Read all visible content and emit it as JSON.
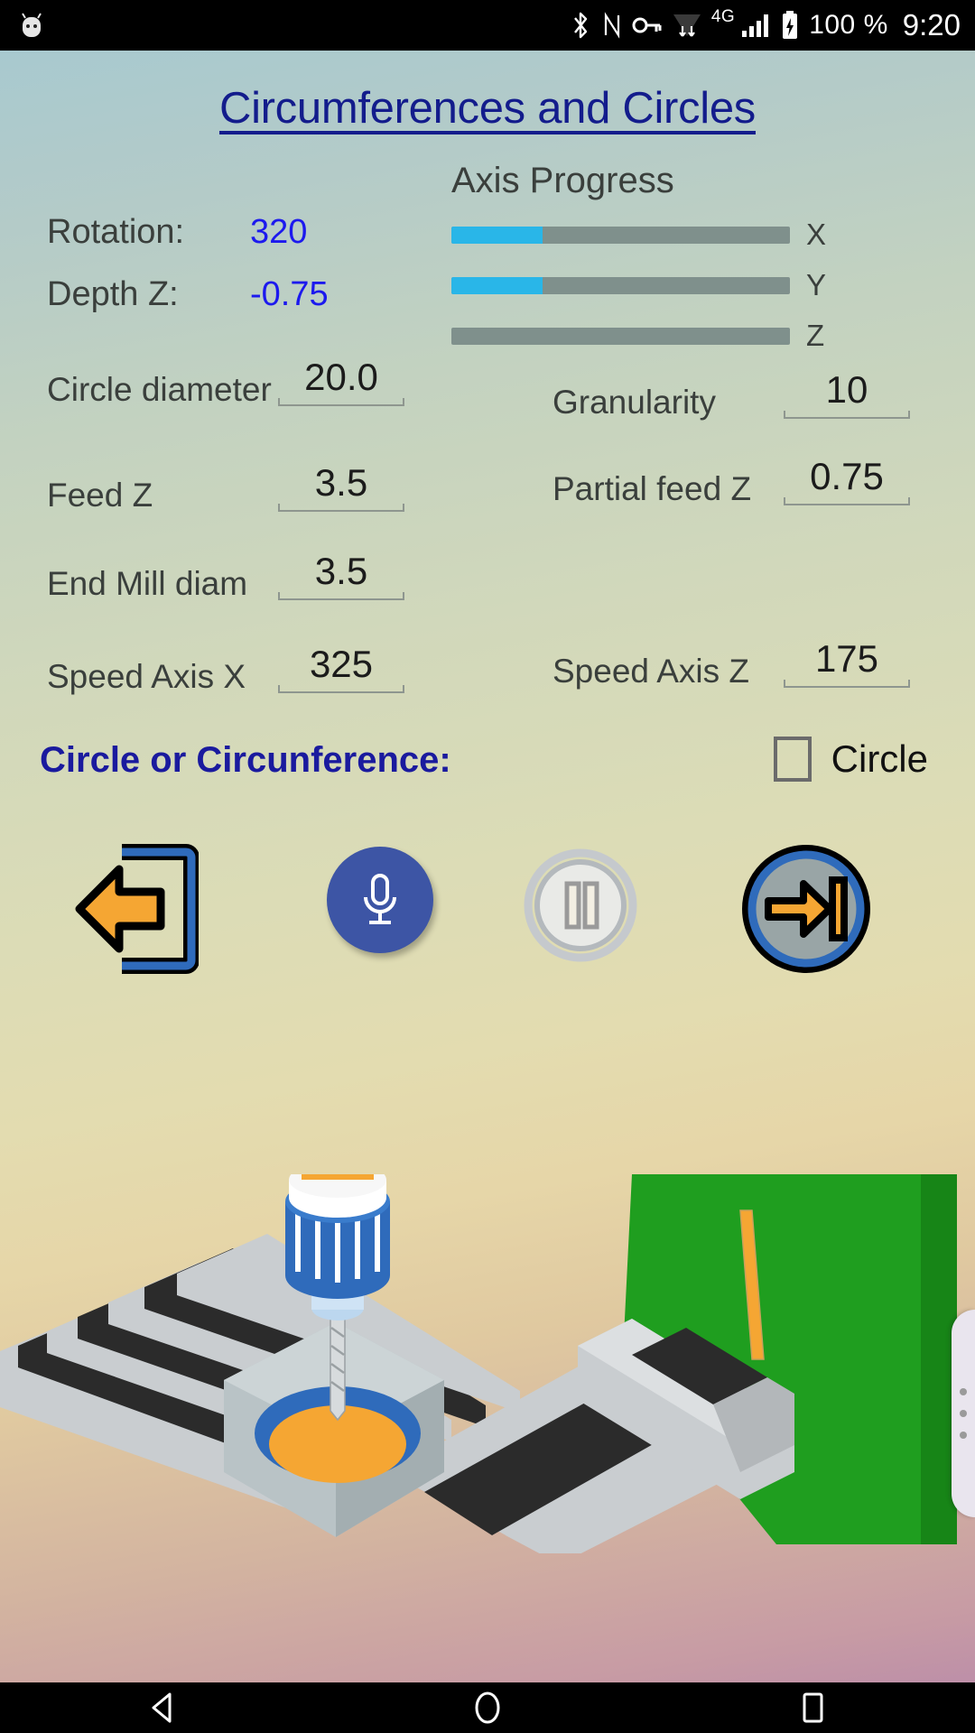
{
  "status_bar": {
    "left_icon": "android-robot-icon",
    "icons": [
      "bluetooth-icon",
      "nfc-icon",
      "vpn-key-icon",
      "wifi-icon",
      "signal-icon",
      "battery-charging-icon"
    ],
    "network_type": "4G",
    "battery_percent": "100 %",
    "time": "9:20"
  },
  "app": {
    "title": "Circumferences and Circles",
    "title_color": "#131c8c",
    "accent_value_color": "#1c19ee",
    "progress_fill_color": "#29b6e8",
    "progress_track_color": "#7f908c"
  },
  "readouts": [
    {
      "label": "Rotation:",
      "value": "320"
    },
    {
      "label": "Depth Z:",
      "value": "-0.75"
    }
  ],
  "axis_progress": {
    "title": "Axis Progress",
    "bars": [
      {
        "axis": "X",
        "percent": 27
      },
      {
        "axis": "Y",
        "percent": 27
      },
      {
        "axis": "Z",
        "percent": 0
      }
    ]
  },
  "fields": {
    "left": [
      {
        "label": "Circle diameter",
        "value": "20.0"
      },
      {
        "label": "Feed Z",
        "value": "3.5"
      },
      {
        "label": "End Mill diam",
        "value": "3.5"
      },
      {
        "label": "Speed Axis X",
        "value": "325"
      }
    ],
    "right": [
      {
        "label": "Granularity",
        "value": "10"
      },
      {
        "label": "Partial feed Z",
        "value": "0.75"
      },
      {
        "label": "Speed Axis Z",
        "value": "175"
      }
    ]
  },
  "mode_selector": {
    "label": "Circle or Circunference:",
    "checkbox_label": "Circle",
    "checked": false
  },
  "buttons": [
    {
      "name": "exit-button",
      "icon": "exit-arrow-icon"
    },
    {
      "name": "microphone-button",
      "icon": "microphone-icon"
    },
    {
      "name": "pause-button",
      "icon": "pause-icon"
    },
    {
      "name": "next-button",
      "icon": "skip-next-icon"
    }
  ],
  "illustration": {
    "name": "cnc-milling-machine-illustration"
  },
  "nav_bar": {
    "back": "back-triangle-icon",
    "home": "home-circle-icon",
    "recents": "recents-square-icon"
  }
}
